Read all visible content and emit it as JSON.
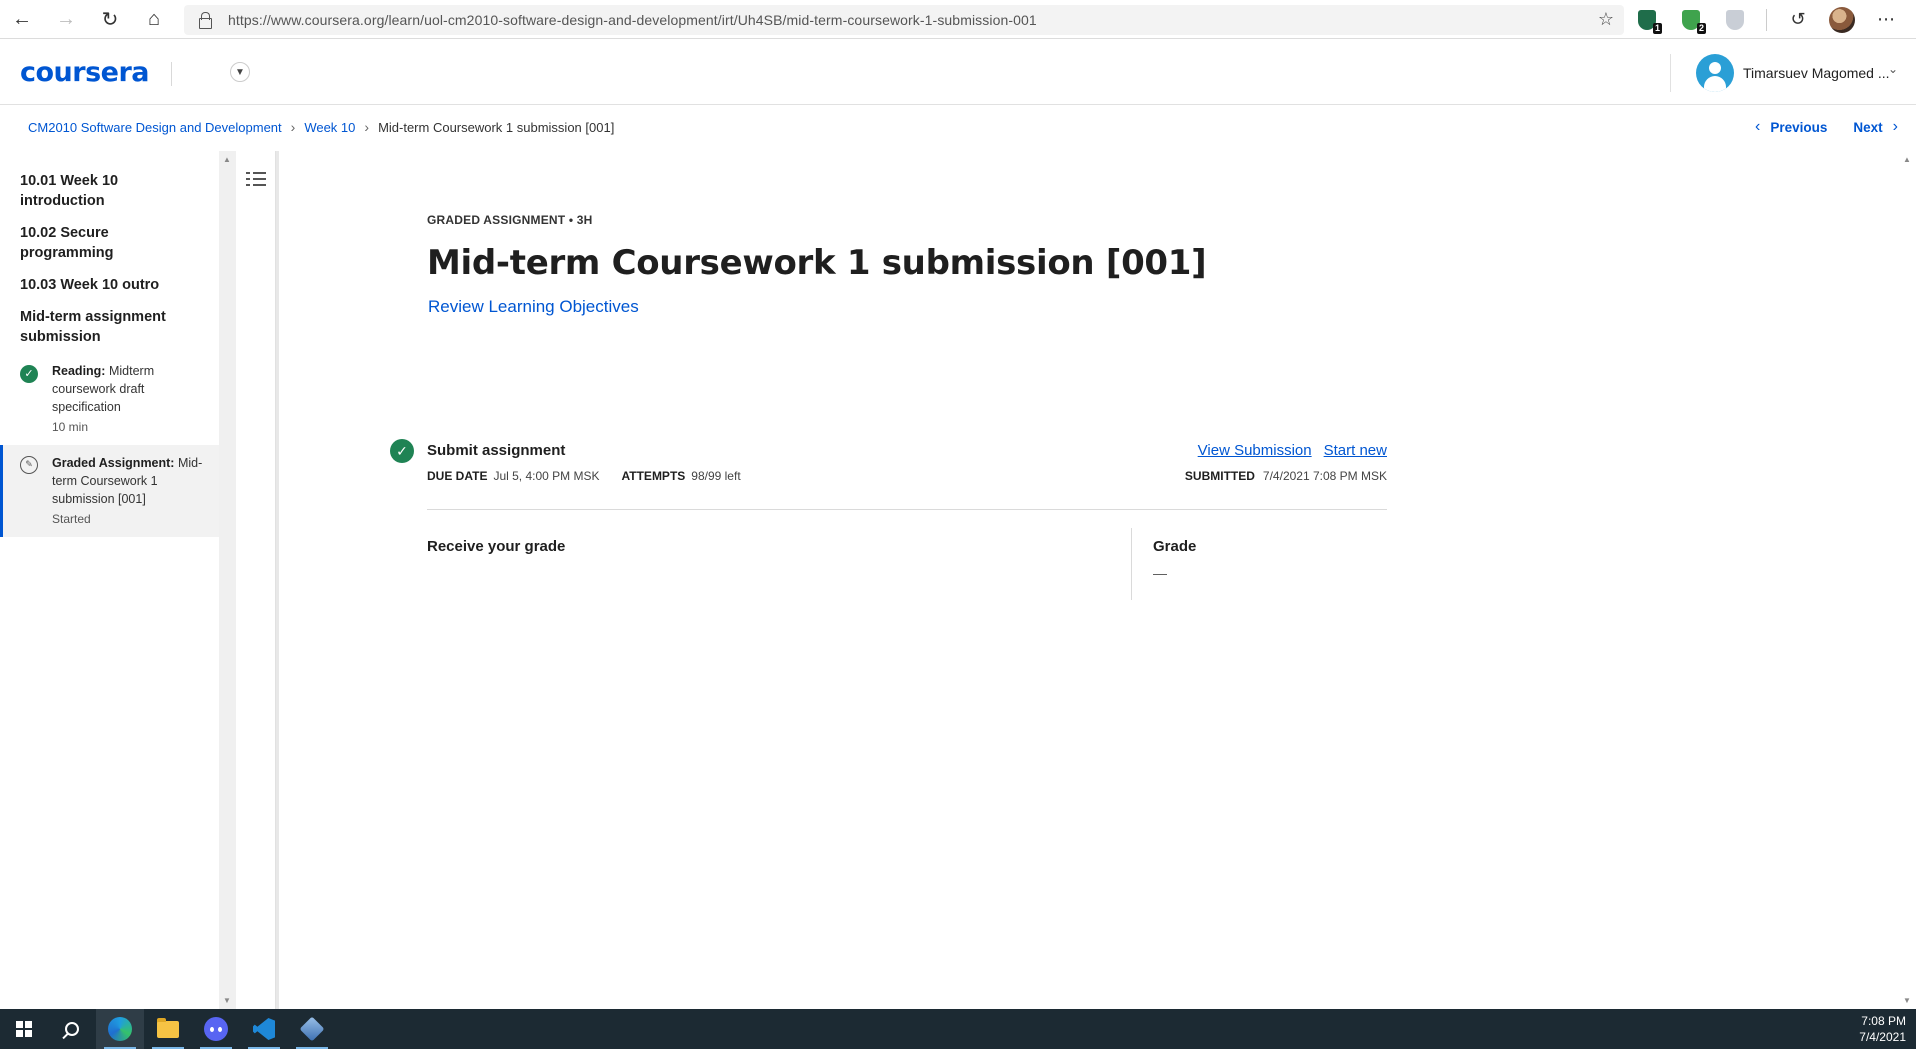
{
  "browser": {
    "url": "https://www.coursera.org/learn/uol-cm2010-software-design-and-development/irt/Uh4SB/mid-term-coursework-1-submission-001",
    "ext_badge_1": "1",
    "ext_badge_2": "2"
  },
  "header": {
    "logo": "coursera",
    "username": "Timarsuev Magomed ..."
  },
  "breadcrumb": {
    "course": "CM2010 Software Design and Development",
    "week": "Week 10",
    "current": "Mid-term Coursework 1 submission [001]"
  },
  "nav": {
    "previous": "Previous",
    "next": "Next"
  },
  "sidebar": {
    "lessons": [
      "10.01 Week 10 introduction",
      "10.02 Secure programming",
      "10.03 Week 10 outro",
      "Mid-term assignment submission"
    ],
    "items": [
      {
        "kind": "Reading:",
        "title": "Midterm coursework draft specification",
        "meta": "10 min"
      },
      {
        "kind": "Graded Assignment:",
        "title": "Mid-term Coursework 1 submission [001]",
        "meta": "Started"
      }
    ]
  },
  "main": {
    "eyebrow": "GRADED ASSIGNMENT • 3H",
    "title": "Mid-term Coursework 1 submission [001]",
    "review_link": "Review Learning Objectives",
    "submit": {
      "title": "Submit assignment",
      "due_label": "DUE DATE",
      "due_value": "Jul 5, 4:00 PM MSK",
      "attempts_label": "ATTEMPTS",
      "attempts_value": "98/99 left",
      "view_submission": "View Submission",
      "start_new": "Start new",
      "submitted_label": "SUBMITTED",
      "submitted_value": "7/4/2021 7:08 PM MSK"
    },
    "grade": {
      "receive_label": "Receive your grade",
      "grade_label": "Grade",
      "grade_value": "—"
    }
  },
  "taskbar": {
    "time": "7:08 PM",
    "date": "7/4/2021"
  },
  "colors": {
    "brand": "#0056d2",
    "success": "#1f8354",
    "taskbar": "#1c2a33"
  }
}
